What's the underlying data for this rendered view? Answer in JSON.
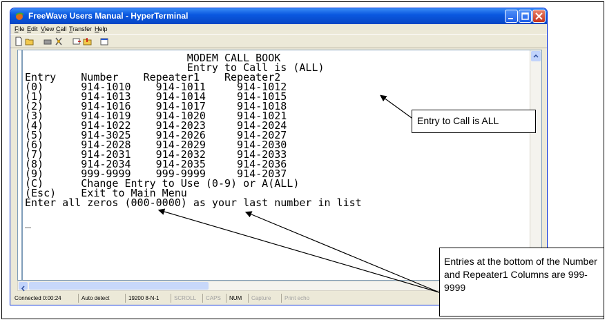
{
  "window": {
    "title": "FreeWave Users Manual - HyperTerminal"
  },
  "menu": {
    "items": [
      "File",
      "Edit",
      "View",
      "Call",
      "Transfer",
      "Help"
    ]
  },
  "toolbar": {
    "icons": [
      "new-icon",
      "open-icon",
      "connect-icon",
      "disconnect-icon",
      "send-icon",
      "receive-icon",
      "properties-icon"
    ]
  },
  "terminal": {
    "lines": [
      "                          MODEM CALL BOOK",
      "                          Entry to Call is (ALL)",
      "Entry    Number    Repeater1    Repeater2",
      "(0)      914-1010    914-1011     914-1012",
      "(1)      914-1013    914-1014     914-1015",
      "(2)      914-1016    914-1017     914-1018",
      "(3)      914-1019    914-1020     914-1021",
      "(4)      914-1022    914-2023     914-2024",
      "(5)      914-3025    914-2026     914-2027",
      "(6)      914-2028    914-2029     914-2030",
      "(7)      914-2031    914-2032     914-2033",
      "(8)      914-2034    914-2035     914-2036",
      "(9)      999-9999    999-9999     914-2037",
      "(C)      Change Entry to Use (0-9) or A(ALL)",
      "(Esc)    Exit to Main Menu",
      "Enter all zeros (000-0000) as your last number in list",
      "",
      "_"
    ]
  },
  "status": {
    "connected": "Connected 0:00:24",
    "detect": "Auto detect",
    "settings": "19200 8-N-1",
    "scroll": "SCROLL",
    "caps": "CAPS",
    "num": "NUM",
    "capture": "Capture",
    "print": "Print echo"
  },
  "callouts": {
    "entry_to_call": "Entry to Call is ALL",
    "bottom_entries": "Entries at the bottom of the Number and Repeater1 Columns are 999-9999"
  },
  "colors": {
    "title_bar": "#0a58e0",
    "close_button": "#c5331d",
    "window_body": "#ece9d8"
  }
}
